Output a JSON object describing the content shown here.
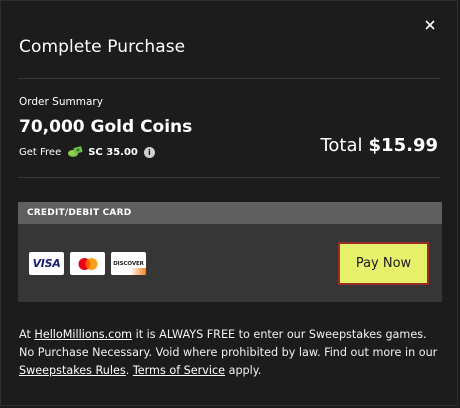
{
  "modal": {
    "title": "Complete Purchase",
    "close_icon": "close-icon"
  },
  "order": {
    "summary_label": "Order Summary",
    "product_name": "70,000 Gold Coins",
    "get_free_label": "Get Free",
    "sc_icon": "sweeps-coins-icon",
    "sc_amount": "SC 35.00",
    "info_icon": "info-icon",
    "info_glyph": "i",
    "total_label": "Total",
    "total_amount": "$15.99"
  },
  "payment": {
    "method_label": "CREDIT/DEBIT CARD",
    "cards": [
      {
        "name": "visa",
        "label": "VISA"
      },
      {
        "name": "mastercard",
        "label": ""
      },
      {
        "name": "discover",
        "label": "DISCOVER"
      }
    ],
    "pay_button_label": "Pay Now"
  },
  "legal": {
    "prefix": "At ",
    "site_link": "HelloMillions.com",
    "body": " it is ALWAYS FREE to enter our Sweepstakes games. No Purchase Necessary. Void where prohibited by law. Find out more in our ",
    "rules_link": "Sweepstakes Rules",
    "separator": ". ",
    "terms_link": "Terms of Service",
    "suffix": " apply."
  },
  "colors": {
    "background": "#1c1c1c",
    "panel": "#363636",
    "panel_header": "#5f5f5f",
    "pay_button": "#e6f06a",
    "pay_button_border": "#9b2e24"
  }
}
